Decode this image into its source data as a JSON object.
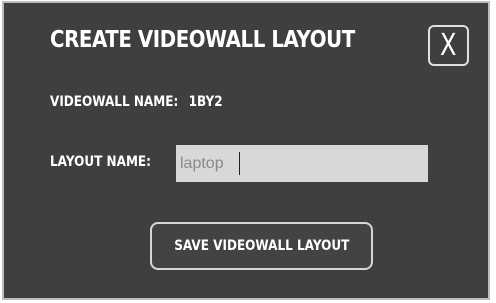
{
  "dialog": {
    "title": "CREATE VIDEOWALL LAYOUT",
    "close_label": "X",
    "videowall_name_label": "VIDEOWALL NAME:",
    "videowall_name_value": "1BY2",
    "layout_name_label": "LAYOUT NAME:",
    "layout_name_value": "laptop",
    "save_label": "SAVE VIDEOWALL LAYOUT"
  },
  "colors": {
    "dialog_background": "#3f3f3f",
    "input_background": "#d8d8d8",
    "input_text": "#8a8a8a",
    "text": "#ffffff",
    "border": "#bdbdbd"
  }
}
